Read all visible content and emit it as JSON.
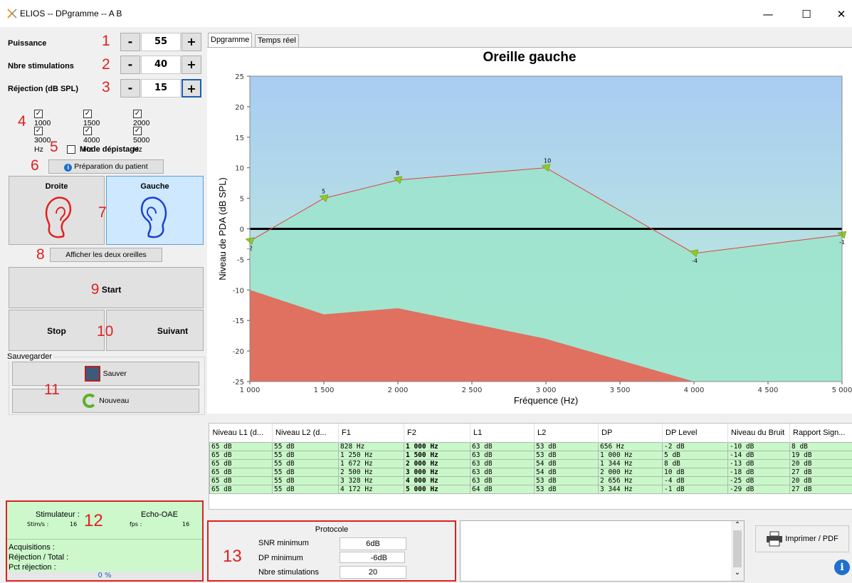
{
  "window": {
    "title": "ELIOS -- DPgramme -- A B",
    "minimize": "—",
    "maximize": "☐",
    "close": "✕"
  },
  "params": {
    "puissance": {
      "label": "Puissance",
      "num": "1",
      "value": "55",
      "minus": "-",
      "plus": "+"
    },
    "stimulations": {
      "label": "Nbre stimulations",
      "num": "2",
      "value": "40",
      "minus": "-",
      "plus": "+"
    },
    "rejection": {
      "label": "Réjection (dB SPL)",
      "num": "3",
      "value": "15",
      "minus": "-",
      "plus": "+"
    }
  },
  "freqs": {
    "num": "4",
    "items": [
      {
        "label": "1000 Hz",
        "checked": true
      },
      {
        "label": "1500 Hz",
        "checked": true
      },
      {
        "label": "2000 Hz",
        "checked": true
      },
      {
        "label": "3000 Hz",
        "checked": true
      },
      {
        "label": "4000 Hz",
        "checked": true
      },
      {
        "label": "5000 Hz",
        "checked": true
      }
    ]
  },
  "screening": {
    "num": "5",
    "label": "Mode dépistage",
    "checked": false
  },
  "prep": {
    "num": "6",
    "label": "Préparation du patient"
  },
  "ears": {
    "num": "7",
    "right": "Droite",
    "left": "Gauche",
    "selected": "left"
  },
  "both": {
    "num": "8",
    "label": "Afficher les deux oreilles"
  },
  "start": {
    "num": "9",
    "label": "Start"
  },
  "stop": {
    "label": "Stop"
  },
  "next": {
    "num": "10",
    "label": "Suivant"
  },
  "save": {
    "group": "Sauvegarder",
    "num": "11",
    "save_label": "Sauver",
    "new_label": "Nouveau"
  },
  "status": {
    "num": "12",
    "stim_title": "Stimulateur :",
    "stim_rate_label": "Stim/s :",
    "stim_rate": "16",
    "echo_title": "Echo-OAE",
    "fps_label": "fps :",
    "fps": "16",
    "acq": "Acquisitions :",
    "rej_total": "Réjection / Total :",
    "pct": "Pct réjection :",
    "progress": "0 %"
  },
  "tabs": [
    {
      "label": "Dpgramme",
      "active": true
    },
    {
      "label": "Temps réel",
      "active": false
    }
  ],
  "chart_title": "Oreille gauche",
  "chart_data": {
    "type": "line",
    "title": "Oreille gauche",
    "xlabel": "Fréquence (Hz)",
    "ylabel": "Niveau de PDA (dB SPL)",
    "xlim": [
      1000,
      5000
    ],
    "ylim": [
      -25,
      25
    ],
    "xticks": [
      "1 000",
      "1 500",
      "2 000",
      "2 500",
      "3 000",
      "3 500",
      "4 000",
      "4 500",
      "5 000"
    ],
    "yticks": [
      "25",
      "20",
      "15",
      "10",
      "5",
      "0",
      "-5",
      "-10",
      "-15",
      "-20",
      "-25"
    ],
    "dp": {
      "x": [
        1000,
        1500,
        2000,
        3000,
        4000,
        5000
      ],
      "y": [
        -2,
        5,
        8,
        10,
        -4,
        -1
      ],
      "labels": [
        "-2",
        "5",
        "8",
        "10",
        "-4",
        "-1"
      ]
    },
    "noise": {
      "x": [
        1000,
        1500,
        2000,
        3000,
        4000,
        5000
      ],
      "y": [
        -10,
        -14,
        -13,
        -18,
        -25,
        -29
      ]
    },
    "colors": {
      "dp_line": "#e04040",
      "noise_fill": "#e07060",
      "dp_fill": "#9ce4cc",
      "bg_top": "#a9ccf2",
      "bg_bottom": "#c0f0d8",
      "marker": "#8ccc20"
    }
  },
  "table": {
    "headers": [
      "Niveau L1 (d...",
      "Niveau L2 (d...",
      "F1",
      "F2",
      "L1",
      "L2",
      "DP",
      "DP Level",
      "Niveau du Bruit",
      "Rapport Sign..."
    ],
    "rows": [
      [
        "65 dB",
        "55 dB",
        "828 Hz",
        "1 000 Hz",
        "63 dB",
        "53 dB",
        "656 Hz",
        "-2 dB",
        "-10 dB",
        "8 dB"
      ],
      [
        "65 dB",
        "55 dB",
        "1 250 Hz",
        "1 500 Hz",
        "63 dB",
        "53 dB",
        "1 000 Hz",
        "5 dB",
        "-14 dB",
        "19 dB"
      ],
      [
        "65 dB",
        "55 dB",
        "1 672 Hz",
        "2 000 Hz",
        "63 dB",
        "54 dB",
        "1 344 Hz",
        "8 dB",
        "-13 dB",
        "20 dB"
      ],
      [
        "65 dB",
        "55 dB",
        "2 500 Hz",
        "3 000 Hz",
        "63 dB",
        "54 dB",
        "2 000 Hz",
        "10 dB",
        "-18 dB",
        "27 dB"
      ],
      [
        "65 dB",
        "55 dB",
        "3 328 Hz",
        "4 000 Hz",
        "63 dB",
        "53 dB",
        "2 656 Hz",
        "-4 dB",
        "-25 dB",
        "20 dB"
      ],
      [
        "65 dB",
        "55 dB",
        "4 172 Hz",
        "5 000 Hz",
        "64 dB",
        "53 dB",
        "3 344 Hz",
        "-1 dB",
        "-29 dB",
        "27 dB"
      ]
    ]
  },
  "protocol": {
    "num": "13",
    "title": "Protocole",
    "rows": [
      {
        "label": "SNR minimum",
        "value": "6dB"
      },
      {
        "label": "DP minimum",
        "value": "-6dB"
      },
      {
        "label": "Nbre stimulations",
        "value": "20"
      }
    ]
  },
  "print": {
    "label": "Imprimer / PDF"
  }
}
